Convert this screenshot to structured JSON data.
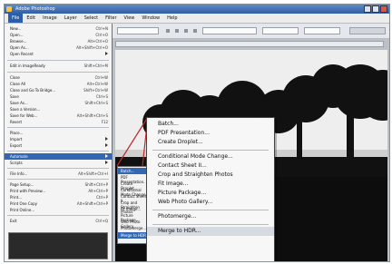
{
  "app": {
    "title": "Adobe Photoshop"
  },
  "menubar": [
    "File",
    "Edit",
    "Image",
    "Layer",
    "Select",
    "Filter",
    "View",
    "Window",
    "Help"
  ],
  "file_menu": {
    "items": [
      {
        "label": "New...",
        "shortcut": "Ctrl+N"
      },
      {
        "label": "Open...",
        "shortcut": "Ctrl+O"
      },
      {
        "label": "Browse...",
        "shortcut": "Alt+Ctrl+O"
      },
      {
        "label": "Open As...",
        "shortcut": "Alt+Shift+Ctrl+O"
      },
      {
        "label": "Open Recent",
        "shortcut": ""
      },
      {
        "label": "Edit in ImageReady",
        "shortcut": "Shift+Ctrl+M"
      },
      {
        "label": "Close",
        "shortcut": "Ctrl+W"
      },
      {
        "label": "Close All",
        "shortcut": "Alt+Ctrl+W"
      },
      {
        "label": "Close and Go To Bridge...",
        "shortcut": "Shift+Ctrl+W"
      },
      {
        "label": "Save",
        "shortcut": "Ctrl+S"
      },
      {
        "label": "Save As...",
        "shortcut": "Shift+Ctrl+S"
      },
      {
        "label": "Save a Version...",
        "shortcut": ""
      },
      {
        "label": "Save for Web...",
        "shortcut": "Alt+Shift+Ctrl+S"
      },
      {
        "label": "Revert",
        "shortcut": "F12"
      },
      {
        "label": "Place...",
        "shortcut": ""
      },
      {
        "label": "Import",
        "shortcut": ""
      },
      {
        "label": "Export",
        "shortcut": ""
      },
      {
        "label": "Automate",
        "shortcut": ""
      },
      {
        "label": "Scripts",
        "shortcut": ""
      },
      {
        "label": "File Info...",
        "shortcut": "Alt+Shift+Ctrl+I"
      },
      {
        "label": "Page Setup...",
        "shortcut": "Shift+Ctrl+P"
      },
      {
        "label": "Print with Preview...",
        "shortcut": "Alt+Ctrl+P"
      },
      {
        "label": "Print...",
        "shortcut": "Ctrl+P"
      },
      {
        "label": "Print One Copy",
        "shortcut": "Alt+Shift+Ctrl+P"
      },
      {
        "label": "Print Online...",
        "shortcut": ""
      },
      {
        "label": "Exit",
        "shortcut": "Ctrl+Q"
      }
    ]
  },
  "submenu": {
    "items": [
      {
        "label": "Batch..."
      },
      {
        "label": "PDF Presentation..."
      },
      {
        "label": "Create Droplet..."
      },
      {
        "label": "Conditional Mode Change..."
      },
      {
        "label": "Contact Sheet II..."
      },
      {
        "label": "Crop and Straighten Photos"
      },
      {
        "label": "Fit Image..."
      },
      {
        "label": "Picture Package..."
      },
      {
        "label": "Web Photo Gallery..."
      },
      {
        "label": "Photomerge..."
      },
      {
        "label": "Merge to HDR..."
      }
    ]
  },
  "automate_menu": {
    "items": [
      "Batch...",
      "PDF Presentation...",
      "Create Droplet...",
      "Conditional Mode Change...",
      "Contact Sheet II...",
      "Crop and Straighten Photos",
      "Fit Image...",
      "Picture Package...",
      "Web Photo Gallery...",
      "Photomerge...",
      "Merge to HDR..."
    ]
  },
  "colors": {
    "highlight": "#3268b3",
    "titlebar": "#2f5ea6"
  }
}
